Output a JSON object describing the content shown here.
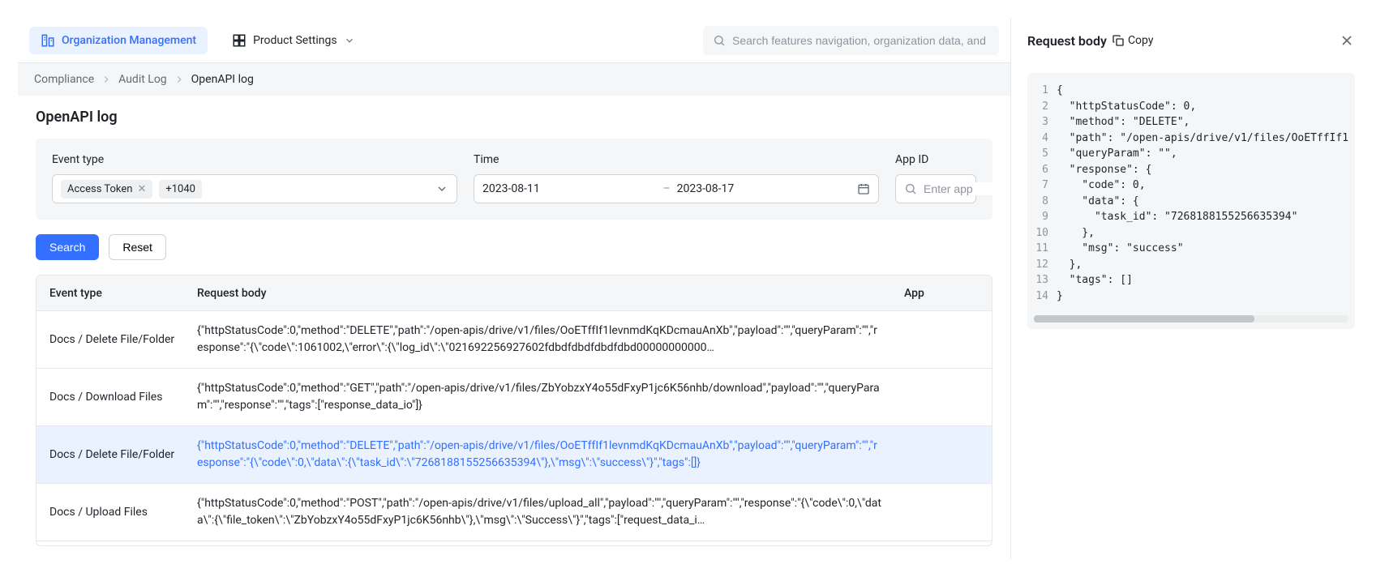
{
  "topbar": {
    "org_mgmt": "Organization Management",
    "prod_settings": "Product Settings",
    "search_placeholder": "Search features navigation, organization data, and r…"
  },
  "breadcrumb": {
    "compliance": "Compliance",
    "audit_log": "Audit Log",
    "current": "OpenAPI log"
  },
  "page_title": "OpenAPI log",
  "filters": {
    "event_type_label": "Event type",
    "chip1": "Access Token",
    "chip2": "+1040",
    "time_label": "Time",
    "date_from": "2023-08-11",
    "date_to": "2023-08-17",
    "appid_label": "App ID",
    "appid_placeholder": "Enter app"
  },
  "buttons": {
    "search": "Search",
    "reset": "Reset"
  },
  "table": {
    "headers": {
      "event_type": "Event type",
      "request_body": "Request body",
      "app": "App"
    },
    "rows": [
      {
        "event_type": "Docs / Delete File/Folder",
        "request_body": "{\"httpStatusCode\":0,\"method\":\"DELETE\",\"path\":\"/open-apis/drive/v1/files/OoETffIf1levnmdKqKDcmauAnXb\",\"payload\":\"\",\"queryParam\":\"\",\"response\":\"{\\\"code\\\":1061002,\\\"error\\\":{\\\"log_id\\\":\\\"021692256927602fdbdfdbdfdbdfdbd00000000000…",
        "selected": false
      },
      {
        "event_type": "Docs / Download Files",
        "request_body": "{\"httpStatusCode\":0,\"method\":\"GET\",\"path\":\"/open-apis/drive/v1/files/ZbYobzxY4o55dFxyP1jc6K56nhb/download\",\"payload\":\"\",\"queryParam\":\"\",\"response\":\"\",\"tags\":[\"response_data_io\"]}",
        "selected": false
      },
      {
        "event_type": "Docs / Delete File/Folder",
        "request_body": "{\"httpStatusCode\":0,\"method\":\"DELETE\",\"path\":\"/open-apis/drive/v1/files/OoETffIf1levnmdKqKDcmauAnXb\",\"payload\":\"\",\"queryParam\":\"\",\"response\":\"{\\\"code\\\":0,\\\"data\\\":{\\\"task_id\\\":\\\"7268188155256635394\\\"},\\\"msg\\\":\\\"success\\\"}\",\"tags\":[]}",
        "selected": true
      },
      {
        "event_type": "Docs / Upload Files",
        "request_body": "{\"httpStatusCode\":0,\"method\":\"POST\",\"path\":\"/open-apis/drive/v1/files/upload_all\",\"payload\":\"\",\"queryParam\":\"\",\"response\":\"{\\\"code\\\":0,\\\"data\\\":{\\\"file_token\\\":\\\"ZbYobzxY4o55dFxyP1jc6K56nhb\\\"},\\\"msg\\\":\\\"Success\\\"}\",\"tags\":[\"request_data_i…",
        "selected": false
      }
    ]
  },
  "sidepanel": {
    "title": "Request body",
    "copy_label": "Copy",
    "code_lines": [
      "{",
      "  \"httpStatusCode\": 0,",
      "  \"method\": \"DELETE\",",
      "  \"path\": \"/open-apis/drive/v1/files/OoETffIf1",
      "  \"queryParam\": \"\",",
      "  \"response\": {",
      "    \"code\": 0,",
      "    \"data\": {",
      "      \"task_id\": \"7268188155256635394\"",
      "    },",
      "    \"msg\": \"success\"",
      "  },",
      "  \"tags\": []",
      "}"
    ]
  }
}
